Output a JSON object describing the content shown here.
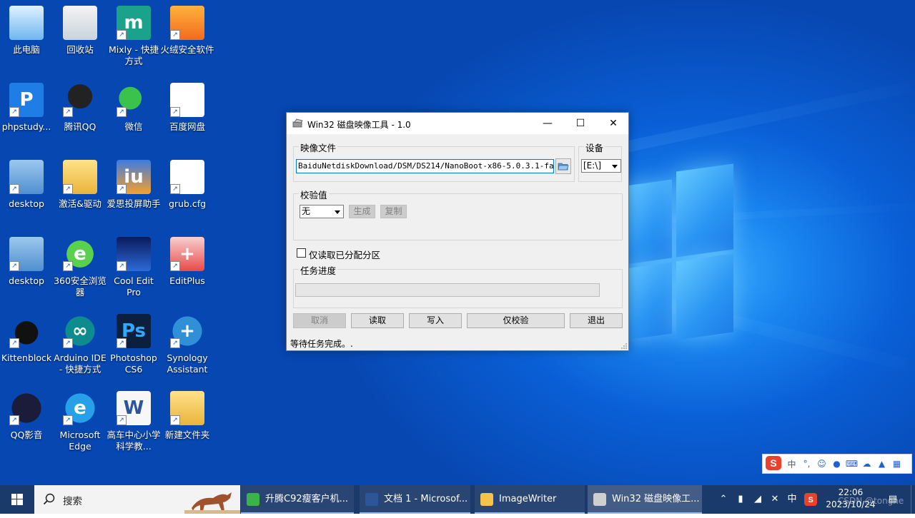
{
  "desktop_icons": [
    {
      "label": "此电脑",
      "icon": "computer-icon"
    },
    {
      "label": "回收站",
      "icon": "recycle-bin-icon"
    },
    {
      "label": "Mixly - 快捷方式",
      "icon": "mixly-icon"
    },
    {
      "label": "火绒安全软件",
      "icon": "huorong-icon"
    },
    {
      "label": "phpstudy...",
      "icon": "phpstudy-icon"
    },
    {
      "label": "腾讯QQ",
      "icon": "qq-icon"
    },
    {
      "label": "微信",
      "icon": "wechat-icon"
    },
    {
      "label": "百度网盘",
      "icon": "baidu-netdisk-icon"
    },
    {
      "label": "desktop",
      "icon": "settings-file-icon"
    },
    {
      "label": "激活&驱动",
      "icon": "folder-icon"
    },
    {
      "label": "爱思投屏助手",
      "icon": "aisi-icon"
    },
    {
      "label": "grub.cfg",
      "icon": "file-icon"
    },
    {
      "label": "desktop",
      "icon": "settings-file-icon"
    },
    {
      "label": "360安全浏览器",
      "icon": "browser-360-icon"
    },
    {
      "label": "Cool Edit Pro",
      "icon": "cool-edit-icon"
    },
    {
      "label": "EditPlus",
      "icon": "editplus-icon"
    },
    {
      "label": "Kittenblock",
      "icon": "kittenblock-icon"
    },
    {
      "label": "Arduino IDE - 快捷方式",
      "icon": "arduino-icon"
    },
    {
      "label": "Photoshop CS6",
      "icon": "photoshop-icon"
    },
    {
      "label": "Synology Assistant",
      "icon": "synology-icon"
    },
    {
      "label": "QQ影音",
      "icon": "qq-player-icon"
    },
    {
      "label": "Microsoft Edge",
      "icon": "edge-icon"
    },
    {
      "label": "高车中心小学科学教...",
      "icon": "word-doc-icon"
    },
    {
      "label": "新建文件夹",
      "icon": "folder-icon"
    }
  ],
  "dialog": {
    "title": "Win32 磁盘映像工具 - 1.0",
    "image_file_label": "映像文件",
    "image_file_value": "BaiduNetdiskDownload/DSM/DS214/NanoBoot-x86-5.0.3.1-fat.img",
    "device_label": "设备",
    "device_value": "[E:\\]",
    "hash_label": "校验值",
    "hash_type": "无",
    "generate_label": "生成",
    "copy_label": "复制",
    "read_only_allocated_label": "仅读取已分配分区",
    "task_progress_label": "任务进度",
    "progress": 0,
    "cancel_label": "取消",
    "read_label": "读取",
    "write_label": "写入",
    "verify_only_label": "仅校验",
    "exit_label": "退出",
    "status_text": "等待任务完成。."
  },
  "taskbar": {
    "search_placeholder": "搜索",
    "apps": [
      {
        "label": "升腾C92瘦客户机...",
        "icon": "browser-360-icon",
        "color": "#3cb34a"
      },
      {
        "label": "文档 1 - Microsof...",
        "icon": "word-icon",
        "color": "#2b579a"
      },
      {
        "label": "ImageWriter",
        "icon": "folder-icon",
        "color": "#f3c34a"
      },
      {
        "label": "Win32 磁盘映像工...",
        "icon": "disk-imager-icon",
        "color": "#cfcfcf"
      }
    ],
    "ime_label": "中",
    "time": "22:06",
    "date": "2023/10/24"
  },
  "ime_bar": {
    "main": "中"
  },
  "watermark": "CSDN @tonghe"
}
